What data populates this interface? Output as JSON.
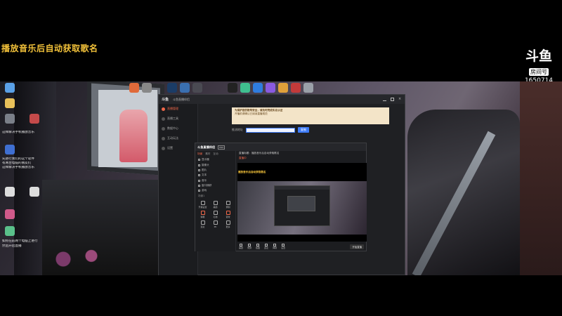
{
  "overlay": {
    "title": "播放音乐后自动获取歌名"
  },
  "douyu": {
    "logo": "斗鱼",
    "room_label": "房间号",
    "room_id": "1650714"
  },
  "desktop": {
    "left_notes": [
      "这样解决手机播放音乐",
      "先进行我们的这个软件",
      "有两台电脑的朋友们",
      "这样解决手机播放音乐",
      "如何在前两个电脑上进行",
      "然后开启直播"
    ]
  },
  "main_window": {
    "logo": "斗鱼",
    "title_text": "斗鱼直播伴侣",
    "sidebar": [
      "直播管理",
      "直播工具",
      "数据中心",
      "互动玩法",
      "设置"
    ],
    "notice_title": "为保护您的账号安全，请及时完成实名认证",
    "notice_line2": "开播前请确认已阅读直播规范",
    "row_label": "推流地址",
    "button": "复制"
  },
  "inner_window": {
    "logo": "斗鱼直播伴侣",
    "badge": "PRO",
    "tabs": [
      "场景",
      "素材",
      "互动"
    ],
    "sources": [
      "显示器",
      "摄像头",
      "图片",
      "文本",
      "音乐",
      "窗口捕获",
      "游戏"
    ],
    "scene_label": "场景1",
    "grid": [
      "开播设置",
      "美颜",
      "录制",
      "弹幕",
      "礼物",
      "音效",
      "连麦",
      "PK",
      "更多"
    ],
    "info_title": "直播标题：播放音乐后自动获取歌名",
    "info_status": "直播中",
    "preview_text": "播放音乐后自动获取歌名",
    "toolbar": [
      "美颜",
      "录屏",
      "截图",
      "连麦",
      "弹幕",
      "设置"
    ],
    "start_button": "开始直播"
  }
}
